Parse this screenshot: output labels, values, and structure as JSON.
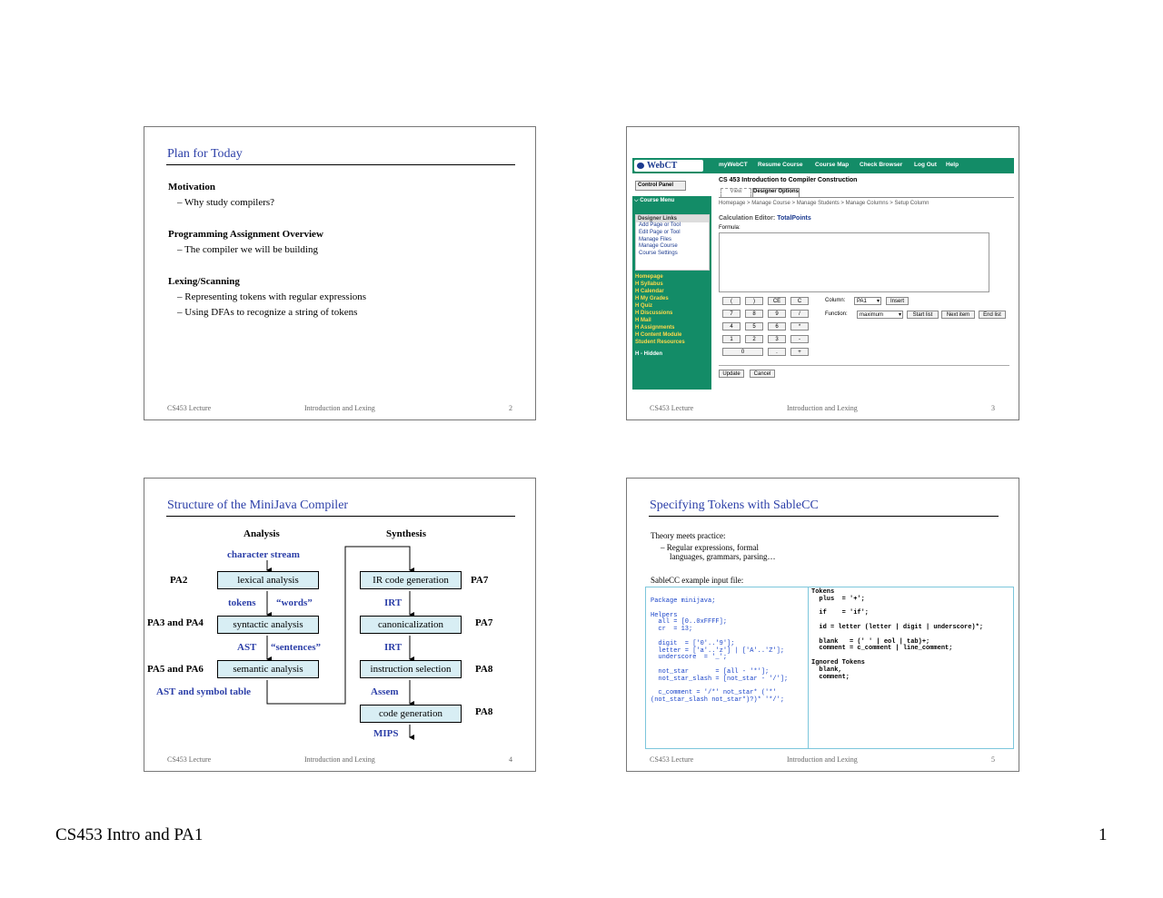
{
  "footer": {
    "left": "CS453 Intro and PA1",
    "page": "1"
  },
  "slides": [
    {
      "title": "Plan for Today",
      "foot": {
        "left": "CS453 Lecture",
        "center": "Introduction and Lexing",
        "num": "2"
      },
      "sections": [
        {
          "heading": "Motivation",
          "bullets": [
            "– Why study compilers?"
          ]
        },
        {
          "heading": "Programming Assignment Overview",
          "bullets": [
            "– The compiler we will be building"
          ]
        },
        {
          "heading": "Lexing/Scanning",
          "bullets": [
            "– Representing tokens with regular expressions",
            "– Using DFAs to recognize a string of tokens"
          ]
        }
      ]
    },
    {
      "foot": {
        "left": "CS453 Lecture",
        "center": "Introduction and Lexing",
        "num": "3"
      },
      "webct": {
        "logo": "WebCT",
        "nav": [
          "myWebCT",
          "Resume Course",
          "Course Map",
          "Check Browser",
          "Log Out",
          "Help"
        ],
        "control_panel": "Control Panel",
        "course_title": "CS 453 Introduction to Compiler Construction",
        "tabs": [
          "View",
          "Designer Options"
        ],
        "course_menu": "Course Menu",
        "breadcrumb": "Homepage > Manage Course > Manage Students > Manage Columns > Setup Column",
        "designer_links_title": "Designer Links",
        "designer_links": [
          "Add Page or Tool",
          "Edit Page or Tool",
          "Manage Files",
          "Manage Course",
          "Course Settings"
        ],
        "menu_items": [
          "Homepage",
          "H Syllabus",
          "H Calendar",
          "H My Grades",
          "H Quiz",
          "H Discussions",
          "H Mail",
          "H Assignments",
          "H Content Module",
          "Student Resources"
        ],
        "hidden_note": "H - Hidden",
        "calc_label": "Calculation Editor:",
        "calc_value": "TotalPoints",
        "formula_label": "Formula:",
        "keys": [
          "(",
          ")",
          "CE",
          "C",
          "7",
          "8",
          "9",
          "/",
          "4",
          "5",
          "6",
          "*",
          "1",
          "2",
          "3",
          "-",
          "0",
          ".",
          "+"
        ],
        "column_label": "Column:",
        "column_value": "PA1",
        "insert": "Insert",
        "function_label": "Function:",
        "function_value": "maximum",
        "list_buttons": [
          "Start list",
          "Next item",
          "End list"
        ],
        "update": "Update",
        "cancel": "Cancel"
      }
    },
    {
      "title": "Structure of the MiniJava Compiler",
      "foot": {
        "left": "CS453 Lecture",
        "center": "Introduction and Lexing",
        "num": "4"
      },
      "diagram": {
        "analysis": "Analysis",
        "synthesis": "Synthesis",
        "left_boxes": [
          "lexical analysis",
          "syntactic analysis",
          "semantic analysis"
        ],
        "right_boxes": [
          "IR code generation",
          "canonicalization",
          "instruction selection",
          "code generation"
        ],
        "left_pa": [
          "PA2",
          "PA3 and PA4",
          "PA5 and PA6"
        ],
        "right_pa": [
          "PA7",
          "PA7",
          "PA8",
          "PA8"
        ],
        "flow_labels": [
          "character stream",
          "tokens",
          "“words”",
          "AST",
          "“sentences”",
          "AST and symbol table"
        ],
        "right_flow": [
          "IRT",
          "IRT",
          "Assem",
          "MIPS"
        ]
      }
    },
    {
      "title": "Specifying Tokens with SableCC",
      "foot": {
        "left": "CS453 Lecture",
        "center": "Introduction and Lexing",
        "num": "5"
      },
      "intro": "Theory meets practice:",
      "bullet1": "– Regular expressions, formal",
      "bullet2": "languages, grammars, parsing…",
      "example_label": "SableCC example input file:",
      "code_left": "Package minijava;\n\nHelpers\n  all = [0..0xFFFF];\n  cr  = 13;\n\n  digit  = ['0'..'9'];\n  letter = ['a'..'z'] | ['A'..'Z'];\n  underscore  = '_';\n\n  not_star       = [all - '*'];\n  not_star_slash = [not_star - '/'];\n\n  c_comment = '/*' not_star* ('*'\n(not_star_slash not_star*)?)* '*/';",
      "code_right": "Tokens\n  plus  = '+';\n\n  if    = 'if';\n\n  id = letter (letter | digit | underscore)*;\n\n  blank   = (' ' | eol | tab)+;\n  comment = c_comment | line_comment;\n\nIgnored Tokens\n  blank,\n  comment;"
    }
  ]
}
